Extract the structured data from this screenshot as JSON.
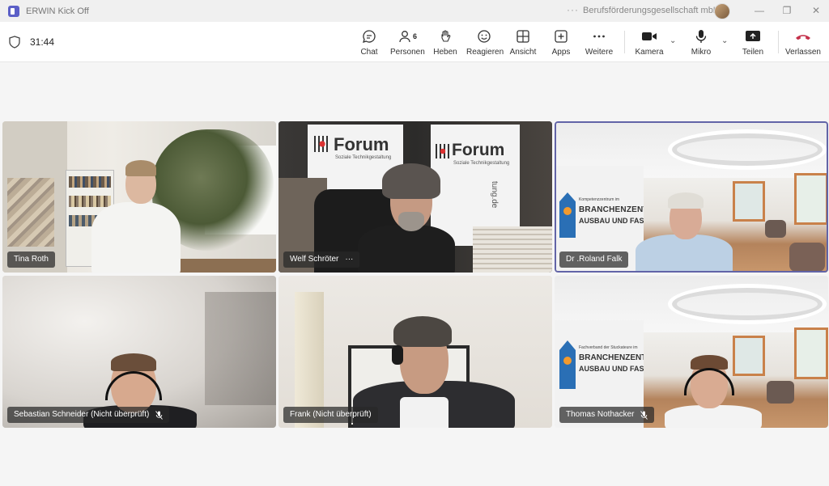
{
  "window": {
    "title": "ERWIN Kick Off",
    "organization": "Berufsförderungsgesellschaft mbH",
    "more": "···"
  },
  "toolbar": {
    "timer": "31:44",
    "buttons": [
      {
        "id": "chat",
        "label": "Chat",
        "icon": "chat-icon"
      },
      {
        "id": "people",
        "label": "Personen",
        "icon": "people-icon",
        "badge": "6"
      },
      {
        "id": "raise",
        "label": "Heben",
        "icon": "hand-icon"
      },
      {
        "id": "react",
        "label": "Reagieren",
        "icon": "smile-icon"
      },
      {
        "id": "view",
        "label": "Ansicht",
        "icon": "grid-icon"
      },
      {
        "id": "apps",
        "label": "Apps",
        "icon": "plus-icon"
      },
      {
        "id": "more",
        "label": "Weitere",
        "icon": "dots-icon"
      },
      {
        "id": "camera",
        "label": "Kamera",
        "icon": "camera-icon"
      },
      {
        "id": "mic",
        "label": "Mikro",
        "icon": "mic-icon"
      },
      {
        "id": "share",
        "label": "Teilen",
        "icon": "share-icon"
      },
      {
        "id": "leave",
        "label": "Verlassen",
        "icon": "phone-hangup-icon"
      }
    ]
  },
  "participants": [
    {
      "name": "Tina Roth",
      "muted": false,
      "more": false
    },
    {
      "name": "Welf Schröter",
      "muted": false,
      "more": true
    },
    {
      "name": "Dr .Roland Falk",
      "muted": false,
      "more": false,
      "speaking": true
    },
    {
      "name": "Sebastian Schneider (Nicht überprüft)",
      "muted": true,
      "more": false
    },
    {
      "name": "Frank (Nicht überprüft)",
      "muted": false,
      "more": false
    },
    {
      "name": "Thomas Nothacker",
      "muted": true,
      "more": false
    }
  ],
  "backgrounds": {
    "forum_banner": "Forum",
    "forum_sub": "Soziale Technikgestaltung",
    "forum_side": "tung.de",
    "kompetenz_small": "Kompetenzzentrum im",
    "fachverband_small": "Fachverband der Stuckateure im",
    "zentrum_line1": "BRANCHENZENTRUM",
    "zentrum_line2": "AUSBAU UND FASSADE"
  },
  "colors": {
    "accent": "#6264a7",
    "leave": "#c4314b"
  }
}
